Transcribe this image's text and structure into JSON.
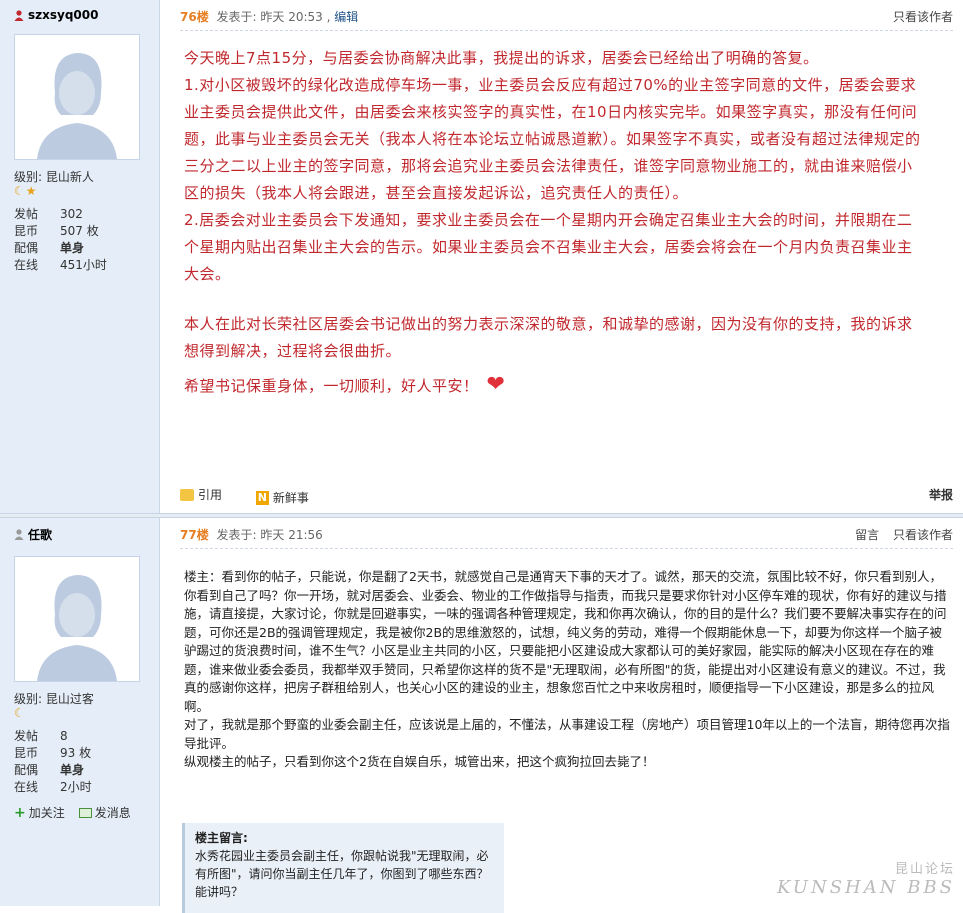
{
  "post1": {
    "username": "szxsyq000",
    "level": "级别: 昆山新人",
    "stars": "☾★",
    "stats": [
      {
        "label": "发帖",
        "value": "302",
        "bold": false
      },
      {
        "label": "昆币",
        "value": "507 枚",
        "bold": false
      },
      {
        "label": "配偶",
        "value": "单身",
        "bold": true
      },
      {
        "label": "在线",
        "value": "451小时",
        "bold": false
      }
    ],
    "floor": "76楼",
    "posted": "发表于: 昨天 20:53",
    "edit": "编辑",
    "only_author": "只看该作者",
    "paragraphs": [
      "今天晚上7点15分，与居委会协商解决此事，我提出的诉求，居委会已经给出了明确的答复。",
      "1.对小区被毁坏的绿化改造成停车场一事，业主委员会反应有超过70%的业主签字同意的文件，居委会要求业主委员会提供此文件，由居委会来核实签字的真实性，在10日内核实完毕。如果签字真实，那没有任何问题，此事与业主委员会无关（我本人将在本论坛立帖诚恳道歉）。如果签字不真实，或者没有超过法律规定的三分之二以上业主的签字同意，那将会追究业主委员会法律责任，谁签字同意物业施工的，就由谁来赔偿小区的损失（我本人将会跟进，甚至会直接发起诉讼，追究责任人的责任）。",
      "2.居委会对业主委员会下发通知，要求业主委员会在一个星期内开会确定召集业主大会的时间，并限期在二个星期内贴出召集业主大会的告示。如果业主委员会不召集业主大会，居委会将会在一个月内负责召集业主大会。",
      "",
      "本人在此对长荣社区居委会书记做出的努力表示深深的敬意，和诚挚的感谢，因为没有你的支持，我的诉求想得到解决，过程将会很曲折。",
      "希望书记保重身体，一切顺利，好人平安！"
    ],
    "quote_label": "引用",
    "news_label": "新鲜事",
    "report_label": "举报"
  },
  "post2": {
    "username": "任歌",
    "level": "级别: 昆山过客",
    "stars": "☾",
    "stats": [
      {
        "label": "发帖",
        "value": "8",
        "bold": false
      },
      {
        "label": "昆币",
        "value": "93 枚",
        "bold": false
      },
      {
        "label": "配偶",
        "value": "单身",
        "bold": true
      },
      {
        "label": "在线",
        "value": "2小时",
        "bold": false
      }
    ],
    "follow_label": "加关注",
    "message_label": "发消息",
    "floor": "77楼",
    "posted": "发表于: 昨天 21:56",
    "leave_msg": "留言",
    "only_author": "只看该作者",
    "paragraphs": [
      "楼主：看到你的帖子，只能说，你是翻了2天书，就感觉自己是通宵天下事的天才了。诚然，那天的交流，氛围比较不好，你只看到别人，你看到自己了吗？你一开场，就对居委会、业委会、物业的工作做指导与指责，而我只是要求你针对小区停车难的现状，你有好的建议与措施，请直接提，大家讨论，你就是回避事实，一味的强调各种管理规定，我和你再次确认，你的目的是什么？我们要不要解决事实存在的问题，可你还是2B的强调管理规定，我是被你2B的思维激怒的，试想，纯义务的劳动，难得一个假期能休息一下，却要为你这样一个脑子被驴踢过的货浪费时间，谁不生气？小区是业主共同的小区，只要能把小区建设成大家都认可的美好家园，能实际的解决小区现在存在的难题，谁来做业委会委员，我都举双手赞同，只希望你这样的货不是\"无理取闹，必有所图\"的货，能提出对小区建设有意义的建议。不过，我真的感谢你这样，把房子群租给别人，也关心小区的建设的业主，想象您百忙之中来收房租时，顺便指导一下小区建设，那是多么的拉风啊。",
      "对了，我就是那个野蛮的业委会副主任，应该说是上届的，不懂法，从事建设工程（房地产）项目管理10年以上的一个法盲，期待您再次指导批评。",
      "纵观楼主的帖子，只看到你这个2货在自娱自乐，城管出来，把这个疯狗拉回去毙了！"
    ],
    "quote_title": "楼主留言:",
    "quote_text": "水秀花园业主委员会副主任，你跟帖说我\"无理取闹，必有所图\"，请问你当副主任几年了，你图到了哪些东西？能讲吗？"
  },
  "watermark": {
    "top": "昆山论坛",
    "bottom": "KUNSHAN BBS"
  }
}
